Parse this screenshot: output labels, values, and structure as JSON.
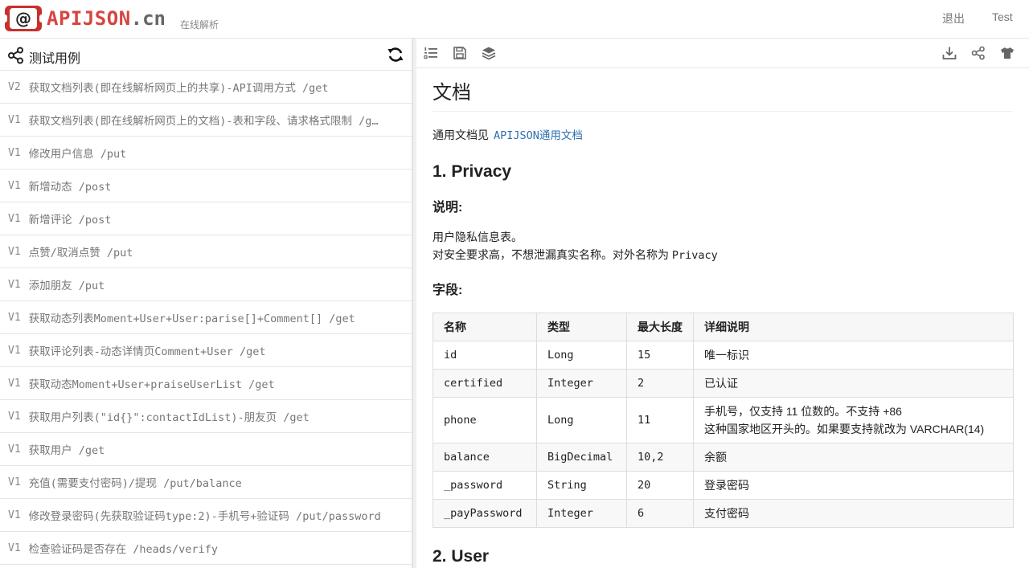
{
  "header": {
    "logo_name": "APIJSON",
    "logo_tld": ".cn",
    "logo_sub": "在线解析",
    "logout": "退出",
    "test": "Test"
  },
  "left": {
    "title": "测试用例",
    "cases": [
      {
        "ver": "V2",
        "name": "获取文档列表(即在线解析网页上的共享)-API调用方式 /get"
      },
      {
        "ver": "V1",
        "name": "获取文档列表(即在线解析网页上的文档)-表和字段、请求格式限制 /g…"
      },
      {
        "ver": "V1",
        "name": "修改用户信息 /put"
      },
      {
        "ver": "V1",
        "name": "新增动态 /post"
      },
      {
        "ver": "V1",
        "name": "新增评论 /post"
      },
      {
        "ver": "V1",
        "name": "点赞/取消点赞 /put"
      },
      {
        "ver": "V1",
        "name": "添加朋友 /put"
      },
      {
        "ver": "V1",
        "name": "获取动态列表Moment+User+User:parise[]+Comment[] /get"
      },
      {
        "ver": "V1",
        "name": "获取评论列表-动态详情页Comment+User /get"
      },
      {
        "ver": "V1",
        "name": "获取动态Moment+User+praiseUserList /get"
      },
      {
        "ver": "V1",
        "name": "获取用户列表(\"id{}\":contactIdList)-朋友页 /get"
      },
      {
        "ver": "V1",
        "name": "获取用户 /get"
      },
      {
        "ver": "V1",
        "name": "充值(需要支付密码)/提现 /put/balance"
      },
      {
        "ver": "V1",
        "name": "修改登录密码(先获取验证码type:2)-手机号+验证码 /put/password"
      },
      {
        "ver": "V1",
        "name": "检查验证码是否存在 /heads/verify"
      }
    ]
  },
  "doc": {
    "title": "文档",
    "intro": "通用文档见",
    "intro_link": "APIJSON通用文档",
    "section1": "1. Privacy",
    "desc_heading": "说明:",
    "desc_line1": "用户隐私信息表。",
    "desc_line2_prefix": "对安全要求高，不想泄漏真实名称。对外名称为",
    "desc_line2_name": "Privacy",
    "fields_heading": "字段:",
    "table": {
      "headers": [
        "名称",
        "类型",
        "最大长度",
        "详细说明"
      ],
      "rows": [
        {
          "name": "id",
          "type": "Long",
          "len": "15",
          "desc1": "唯一标识",
          "desc2": ""
        },
        {
          "name": "certified",
          "type": "Integer",
          "len": "2",
          "desc1": "已认证",
          "desc2": ""
        },
        {
          "name": "phone",
          "type": "Long",
          "len": "11",
          "desc1": "手机号，仅支持 11 位数的。不支持 +86",
          "desc2": "这种国家地区开头的。如果要支持就改为 VARCHAR(14)"
        },
        {
          "name": "balance",
          "type": "BigDecimal",
          "len": "10,2",
          "desc1": "余额",
          "desc2": ""
        },
        {
          "name": "_password",
          "type": "String",
          "len": "20",
          "desc1": "登录密码",
          "desc2": ""
        },
        {
          "name": "_payPassword",
          "type": "Integer",
          "len": "6",
          "desc1": "支付密码",
          "desc2": ""
        }
      ]
    },
    "section2": "2. User"
  },
  "colors": {
    "brand": "#d64541",
    "link": "#2f6fb0",
    "border": "#e5e5e5"
  },
  "icons": {
    "left_toolbar": [
      "share-nodes-icon",
      "refresh-icon"
    ],
    "right_toolbar_left": [
      "list-ordered-icon",
      "save-icon",
      "layers-icon"
    ],
    "right_toolbar_right": [
      "download-icon",
      "share-icon",
      "shirt-icon"
    ]
  }
}
